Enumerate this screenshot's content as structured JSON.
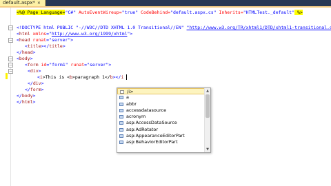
{
  "tab": {
    "title": "default.aspx*",
    "close": "×"
  },
  "code": {
    "l1": {
      "a": "<%@ Page Language=",
      "b": "\"C#\"",
      "c": " AutoEventWireup=",
      "d": "\"true\"",
      "e": " CodeBehind=",
      "f": "\"default.aspx.cs\"",
      "g": " Inherits=",
      "h": "\"HTMLTest._default\"",
      "i": " %>"
    },
    "l3": {
      "a": "<!DOCTYPE html PUBLIC \"-//W3C//DTD XHTML 1.0 Transitional//EN\" ",
      "b": "\"http://www.w3.org/TR/xhtml1/DTD/xhtml1-transitional.dtd\""
    },
    "l4": {
      "a": "<",
      "b": "html",
      "c": " xmlns",
      "d": "=\"",
      "e": "http://www.w3.org/1999/xhtml",
      "f": "\">"
    },
    "l5": {
      "a": "<",
      "b": "head",
      "c": " runat",
      "d": "=\"server\">"
    },
    "l6": {
      "a": "<",
      "b": "title",
      "c": "></",
      "d": "title",
      "e": ">"
    },
    "l7": {
      "a": "</",
      "b": "head",
      "c": ">"
    },
    "l8": {
      "a": "<",
      "b": "body",
      "c": ">"
    },
    "l9": {
      "a": "<",
      "b": "form",
      "c": " id",
      "d": "=\"form1\"",
      "e": " runat",
      "f": "=\"server\">"
    },
    "l10": {
      "a": "<",
      "b": "div",
      "c": ">"
    },
    "l11": {
      "a": "<",
      "b": "i",
      "c": ">This is <",
      "d": "b",
      "e": ">paragraph 1</",
      "f": "b",
      "g": "></",
      "h": "i"
    },
    "l12": {
      "a": "</",
      "b": "div",
      "c": ">"
    },
    "l13": {
      "a": "</",
      "b": "form",
      "c": ">"
    },
    "l14": {
      "a": "</",
      "b": "body",
      "c": ">"
    },
    "l15": {
      "a": "</",
      "b": "html",
      "c": ">"
    }
  },
  "completion": {
    "items": [
      "/i>",
      "a",
      "abbr",
      "accessdatasource",
      "acronym",
      "asp:AccessDataSource",
      "asp:AdRotator",
      "asp:AppearanceEditorPart",
      "asp:BehaviorEditorPart"
    ]
  },
  "colors": {
    "tag": "#a31515",
    "attr": "#ff0000",
    "delim": "#0000ff",
    "tab_bg": "#fdf1a6",
    "chrome": "#293955"
  }
}
